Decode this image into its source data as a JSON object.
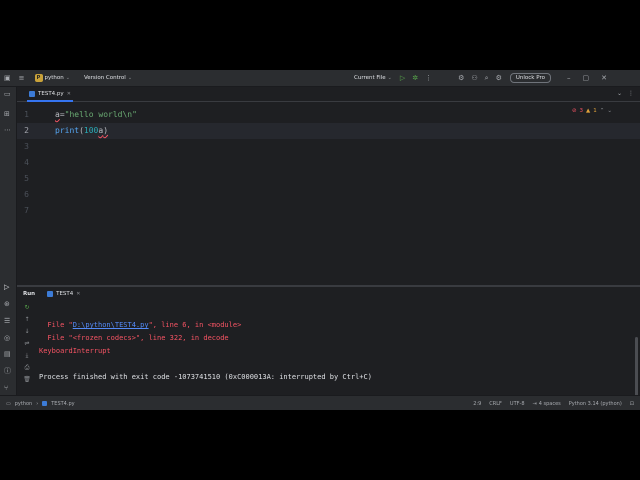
{
  "titlebar": {
    "project_badge": "P",
    "project_name": "python",
    "vcs": "Version Control",
    "run_config": "Current File",
    "unlock": "Unlock Pro"
  },
  "editor": {
    "tab_name": "TEST4.py",
    "line_numbers": [
      "1",
      "2",
      "3",
      "4",
      "5",
      "6",
      "7"
    ],
    "line1": {
      "var": "a",
      "eq": "=",
      "str": "\"hello world\\n\""
    },
    "line2": {
      "fn": "print",
      "open": "(",
      "num": "100",
      "rest": "a",
      "close": ")"
    },
    "error_count": "3",
    "warning_count": "1"
  },
  "run": {
    "label": "Run",
    "tab_name": "TEST4",
    "console": {
      "l1_prefix": "  File \"",
      "l1_link": "D:\\python\\TEST4.py",
      "l1_suffix": "\", line 6, in <module>",
      "l2": "  File \"<frozen codecs>\", line 322, in decode",
      "l3": "KeyboardInterrupt",
      "l4": "",
      "l5": "Process finished with exit code -1073741510 (0xC000013A: interrupted by Ctrl+C)"
    }
  },
  "status": {
    "crumb_project": "python",
    "crumb_file": "TEST4.py",
    "position": "2:9",
    "line_sep": "CRLF",
    "encoding": "UTF-8",
    "indent": "4 spaces",
    "interpreter": "Python 3.14 (python)"
  },
  "colors": {
    "accent": "#3574f0",
    "error": "#f75464",
    "string": "#6aab73",
    "number": "#2aacb8",
    "function": "#56a8f5"
  }
}
